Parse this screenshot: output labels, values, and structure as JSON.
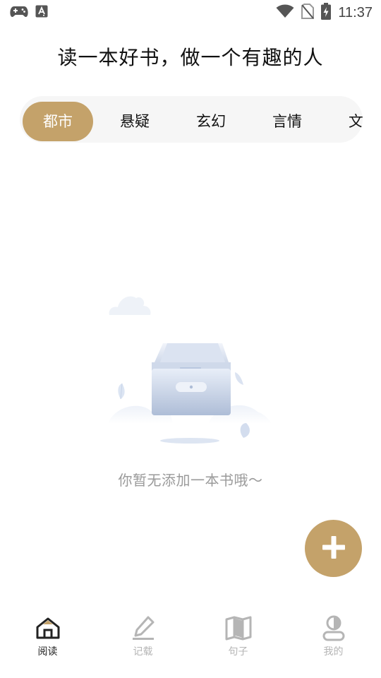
{
  "status_bar": {
    "time": "11:37",
    "icons": [
      "gamepad-icon",
      "font-a-icon",
      "wifi-icon",
      "no-sim-icon",
      "battery-charging-icon"
    ]
  },
  "header": {
    "headline": "读一本好书，做一个有趣的人"
  },
  "categories": {
    "active_index": 0,
    "items": [
      "都市",
      "悬疑",
      "玄幻",
      "言情",
      "文"
    ]
  },
  "empty_state": {
    "message": "你暂无添加一本书哦～",
    "icon": "empty-box-illustration"
  },
  "fab": {
    "icon": "plus-icon"
  },
  "bottom_nav": {
    "active_index": 0,
    "items": [
      {
        "label": "阅读",
        "icon": "home-icon"
      },
      {
        "label": "记载",
        "icon": "pencil-icon"
      },
      {
        "label": "句子",
        "icon": "map-book-icon"
      },
      {
        "label": "我的",
        "icon": "profile-icon"
      }
    ]
  },
  "colors": {
    "accent": "#c4a26a",
    "tab_bg": "#f6f6f6",
    "muted_text": "#9a9a9a"
  }
}
